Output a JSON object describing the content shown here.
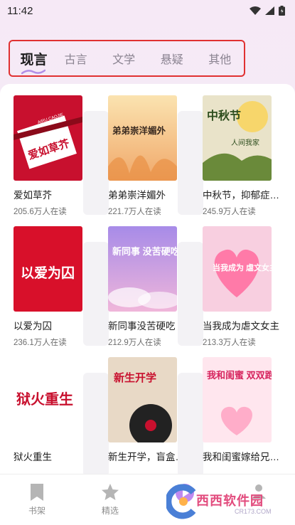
{
  "status_bar": {
    "time": "11:42"
  },
  "tabs": [
    {
      "label": "现言",
      "active": true
    },
    {
      "label": "古言",
      "active": false
    },
    {
      "label": "文学",
      "active": false
    },
    {
      "label": "悬疑",
      "active": false
    },
    {
      "label": "其他",
      "active": false
    }
  ],
  "books": [
    {
      "title": "爱如草芥",
      "readers": "205.6万人在读",
      "cover_text": "爱如草芥",
      "cover_sub": "AIRU CAOJIE",
      "cover_color": "#c8102e"
    },
    {
      "title": "弟弟崇洋媚外",
      "readers": "221.7万人在读",
      "cover_text": "弟弟崇洋媚外",
      "cover_color": "#f6c27a"
    },
    {
      "title": "中秋节，抑郁症…",
      "readers": "245.9万人在读",
      "cover_text": "中秋节",
      "cover_sub": "人间我家",
      "cover_color": "#e9e3c9"
    },
    {
      "title": "以爱为囚",
      "readers": "236.1万人在读",
      "cover_text": "以爱为囚",
      "cover_color": "#d8102a"
    },
    {
      "title": "新同事没苦硬吃",
      "readers": "212.9万人在读",
      "cover_text": "新同事 没苦硬吃",
      "cover_color": "#b99be8"
    },
    {
      "title": "当我成为虐文女主",
      "readers": "213.3万人在读",
      "cover_text": "当我成为 虐文女主",
      "cover_color": "#f8cfe0"
    },
    {
      "title": "狱火重生",
      "readers": "",
      "cover_text": "狱火重生",
      "cover_color": "#ffffff"
    },
    {
      "title": "新生开学，盲盒…",
      "readers": "",
      "cover_text": "新生开学",
      "cover_color": "#e8d9c6"
    },
    {
      "title": "我和闺蜜嫁给兄…",
      "readers": "",
      "cover_text": "我和闺蜜 双双跑路",
      "cover_color": "#ffe6ee"
    }
  ],
  "bottom_nav": [
    {
      "label": "书架",
      "icon": "bookmark-icon"
    },
    {
      "label": "精选",
      "icon": "star-icon"
    },
    {
      "label": "",
      "icon": "play-icon"
    },
    {
      "label": "",
      "icon": "profile-icon"
    }
  ],
  "watermark": {
    "text": "西西软件园",
    "sub": "CR173.COM"
  }
}
